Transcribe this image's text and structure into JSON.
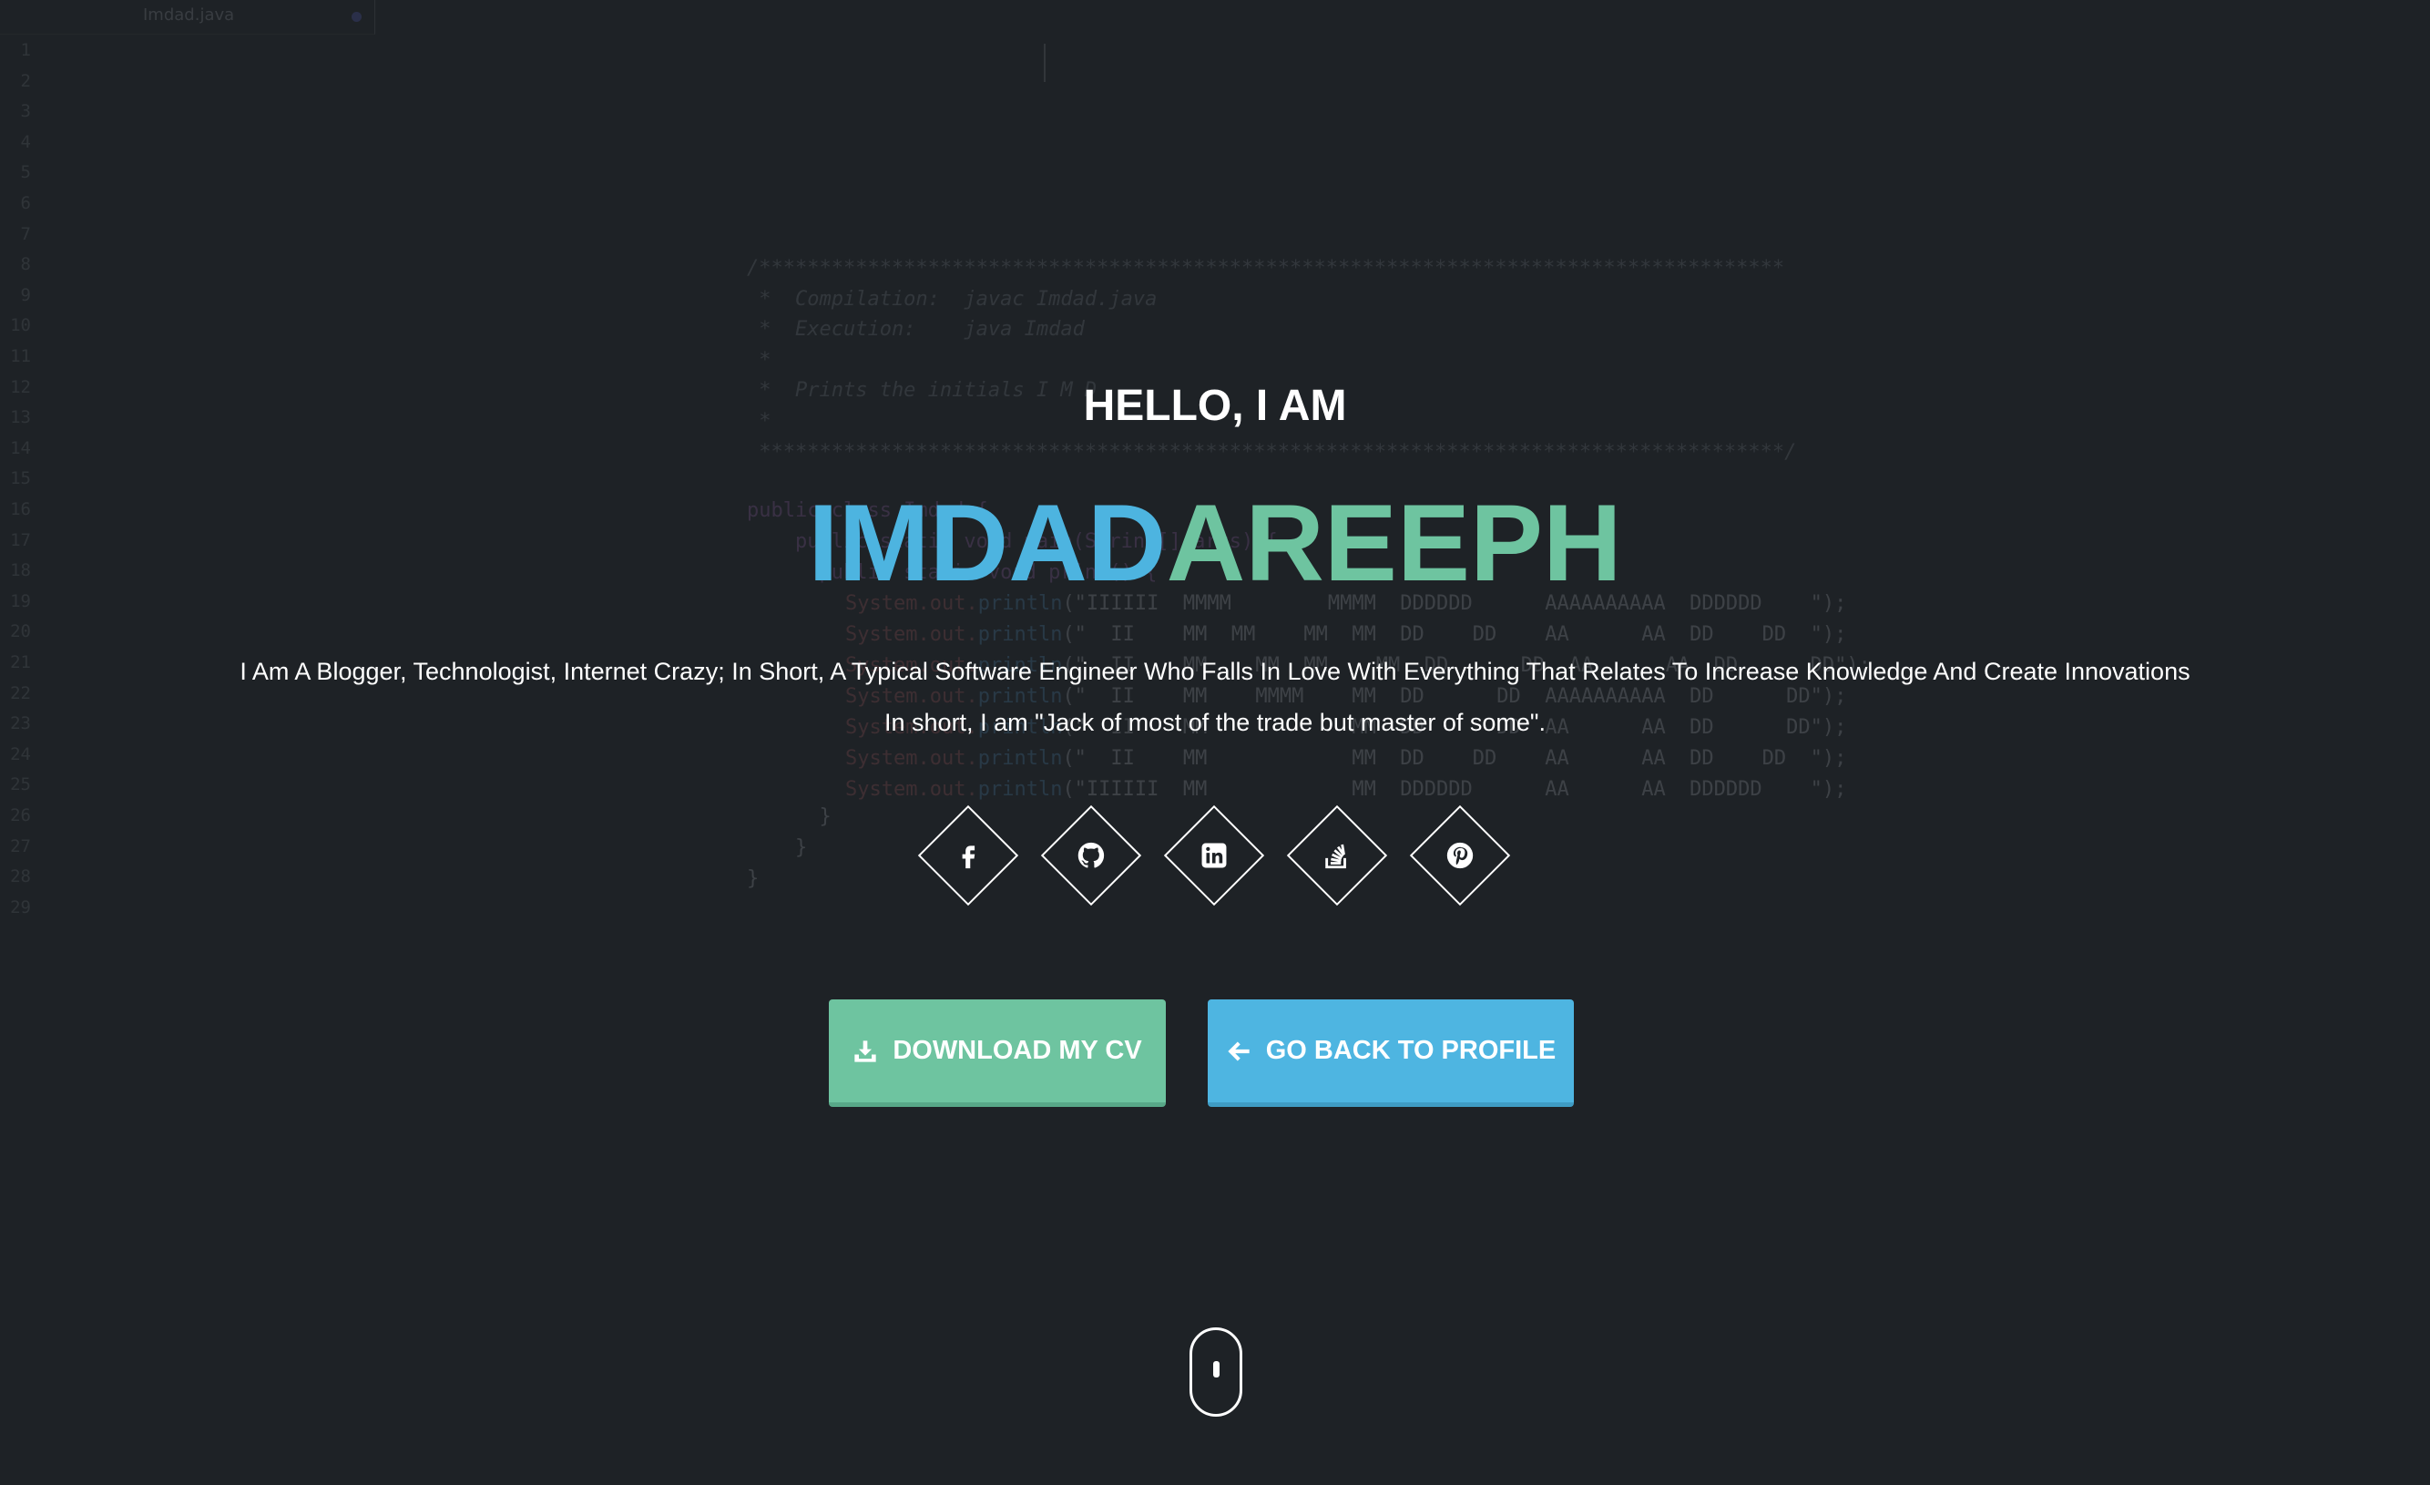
{
  "editor": {
    "tab_filename": "Imdad.java",
    "line_numbers": [
      "1",
      "2",
      "3",
      "4",
      "5",
      "6",
      "7",
      "8",
      "9",
      "10",
      "11",
      "12",
      "13",
      "14",
      "15",
      "16",
      "17",
      "18",
      "19",
      "20",
      "21",
      "22",
      "23",
      "24",
      "25",
      "26",
      "27",
      "28",
      "29"
    ],
    "code": {
      "comment_top": "/*************************************************************************************",
      "comment_compilation": " *  Compilation:  javac Imdad.java",
      "comment_execution": " *  Execution:    java Imdad",
      "comment_blank1": " *",
      "comment_prints": " *  Prints the initials I M D",
      "comment_blank2": " *",
      "comment_bottom": " *************************************************************************************/",
      "class_decl": "public class Imdad {",
      "method_decl": "    public static void main(String[] args) {",
      "inner_decl": "      public static void print() {",
      "print_prefix": "System",
      "print_out": ".out.",
      "print_fn": "println",
      "ascii_rows": [
        "(\"IIIIII  MMMM        MMMM  DDDDDD      AAAAAAAAAA  DDDDDD    \");",
        "(\"  II    MM  MM    MM  MM  DD    DD    AA      AA  DD    DD  \");",
        "(\"  II    MM    MM  MM    MM  DD      DD  AA      AA  DD      DD\");",
        "(\"  II    MM    MMMM    MM  DD      DD  AAAAAAAAAA  DD      DD\");",
        "(\"  II    MM            MM  DD      DD  AA      AA  DD      DD\");",
        "(\"  II    MM            MM  DD    DD    AA      AA  DD    DD  \");",
        "(\"IIIIII  MM            MM  DDDDDD      AA      AA  DDDDDD    \");"
      ],
      "close1": "      }",
      "close2": "    }",
      "close3": "}"
    }
  },
  "hero": {
    "greeting": "HELLO, I AM",
    "first_name": "IMDAD",
    "last_name": "AREEPH",
    "tagline": "I Am A Blogger, Technologist, Internet Crazy; In Short, A Typical Software Engineer Who Falls In Love With Everything That Relates To Increase Knowledge And Create Innovations",
    "quote": "In short, I am \"Jack of most of the trade but master of some\"."
  },
  "social_icons": [
    "facebook-icon",
    "github-icon",
    "linkedin-icon",
    "stackoverflow-icon",
    "pinterest-icon"
  ],
  "buttons": {
    "download_label": "DOWNLOAD MY CV",
    "download_icon": "download-icon",
    "back_label": "GO BACK TO PROFILE",
    "back_icon": "arrow-left-icon"
  },
  "scroll_indicator": "mouse-scroll-icon",
  "colors": {
    "background": "#1e2226",
    "accent_blue": "#4db4e0",
    "accent_green": "#6ec4a0"
  }
}
